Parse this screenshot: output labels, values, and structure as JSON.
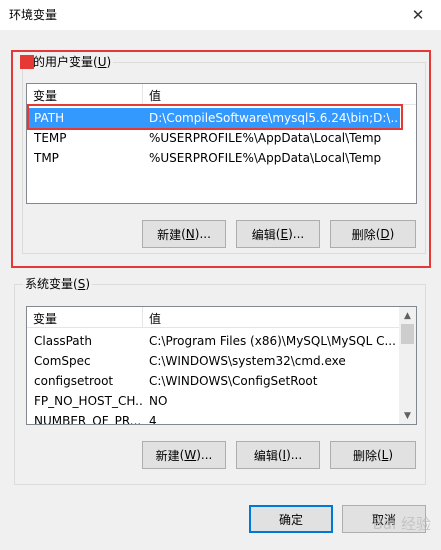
{
  "window": {
    "title": "环境变量",
    "close_glyph": "✕"
  },
  "user_vars": {
    "label": "的用户变量",
    "label_key": "U",
    "headers": {
      "var": "变量",
      "value": "值"
    },
    "rows": [
      {
        "var": "PATH",
        "value": "D:\\CompileSoftware\\mysql5.6.24\\bin;D:\\...",
        "selected": true
      },
      {
        "var": "TEMP",
        "value": "%USERPROFILE%\\AppData\\Local\\Temp",
        "selected": false
      },
      {
        "var": "TMP",
        "value": "%USERPROFILE%\\AppData\\Local\\Temp",
        "selected": false
      }
    ],
    "buttons": {
      "new": "新建",
      "new_key": "N",
      "edit": "编辑",
      "edit_key": "E",
      "delete": "删除",
      "delete_key": "D"
    }
  },
  "system_vars": {
    "label": "系统变量",
    "label_key": "S",
    "headers": {
      "var": "变量",
      "value": "值"
    },
    "rows": [
      {
        "var": "ClassPath",
        "value": "C:\\Program Files (x86)\\MySQL\\MySQL C..."
      },
      {
        "var": "ComSpec",
        "value": "C:\\WINDOWS\\system32\\cmd.exe"
      },
      {
        "var": "configsetroot",
        "value": "C:\\WINDOWS\\ConfigSetRoot"
      },
      {
        "var": "FP_NO_HOST_CH...",
        "value": "NO"
      },
      {
        "var": "NUMBER_OF_PR...",
        "value": "4"
      }
    ],
    "buttons": {
      "new": "新建",
      "new_key": "W",
      "edit": "编辑",
      "edit_key": "I",
      "delete": "删除",
      "delete_key": "L"
    }
  },
  "footer": {
    "ok": "确定",
    "cancel": "取消"
  },
  "watermark": "Bai 经验",
  "colors": {
    "selection": "#3399ff",
    "highlight": "#e53935"
  }
}
